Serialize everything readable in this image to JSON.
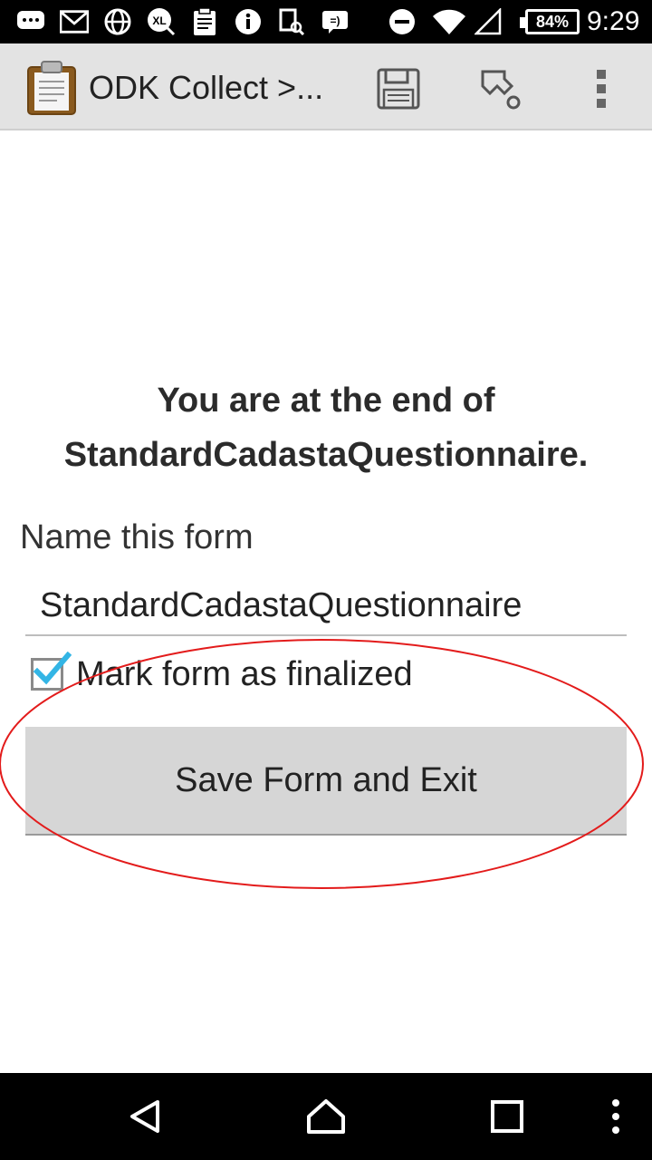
{
  "status_bar": {
    "battery": "84%",
    "time": "9:29",
    "icons": [
      "chat-icon",
      "gmail-icon",
      "globe-icon",
      "xl-icon",
      "clipboard-icon",
      "info-icon",
      "scan-icon",
      "cast-icon",
      "dnd-icon",
      "wifi-icon",
      "signal-icon",
      "battery-icon"
    ]
  },
  "action_bar": {
    "title": "ODK Collect >...",
    "icons": [
      "clipboard-app-icon",
      "save-icon",
      "goto-icon",
      "overflow-menu-icon"
    ]
  },
  "content": {
    "end_message": "You are at the end of StandardCadastaQuestionnaire.",
    "name_label": "Name this form",
    "name_value": "StandardCadastaQuestionnaire",
    "finalize_label": "Mark form as finalized",
    "finalized": true,
    "save_button": "Save Form and Exit"
  },
  "annotation": {
    "color": "#e31b1b"
  },
  "nav_bar": {
    "icons": [
      "back-icon",
      "home-icon",
      "recents-icon",
      "menu-icon"
    ]
  },
  "colors": {
    "accent_check": "#33b5e5",
    "action_bar": "#e3e3e3",
    "button": "#d6d6d6"
  }
}
